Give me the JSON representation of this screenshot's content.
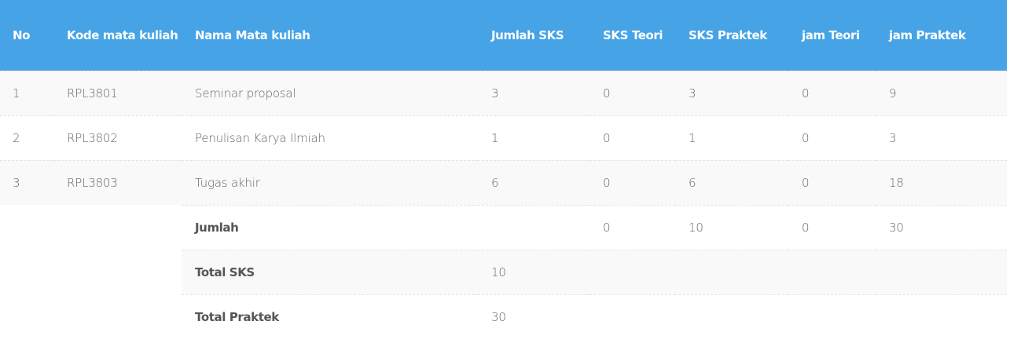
{
  "headers": {
    "no": "No",
    "kode": "Kode mata kuliah",
    "nama": "Nama Mata kuliah",
    "jumlah_sks": "Jumlah SKS",
    "sks_teori": "SKS Teori",
    "sks_praktek": "SKS Praktek",
    "jam_teori": "jam Teori",
    "jam_praktek": "jam Praktek"
  },
  "rows": [
    {
      "no": "1",
      "kode": "RPL3801",
      "nama": "Seminar proposal",
      "jumlah_sks": "3",
      "sks_teori": "0",
      "sks_praktek": "3",
      "jam_teori": "0",
      "jam_praktek": "9"
    },
    {
      "no": "2",
      "kode": "RPL3802",
      "nama": "Penulisan Karya Ilmiah",
      "jumlah_sks": "1",
      "sks_teori": "0",
      "sks_praktek": "1",
      "jam_teori": "0",
      "jam_praktek": "3"
    },
    {
      "no": "3",
      "kode": "RPL3803",
      "nama": "Tugas akhir",
      "jumlah_sks": "6",
      "sks_teori": "0",
      "sks_praktek": "6",
      "jam_teori": "0",
      "jam_praktek": "18"
    }
  ],
  "jumlah": {
    "label": "Jumlah",
    "jumlah_sks": "",
    "sks_teori": "0",
    "sks_praktek": "10",
    "jam_teori": "0",
    "jam_praktek": "30"
  },
  "total_sks": {
    "label": "Total SKS",
    "value": "10"
  },
  "total_praktek": {
    "label": "Total Praktek",
    "value": "30"
  }
}
